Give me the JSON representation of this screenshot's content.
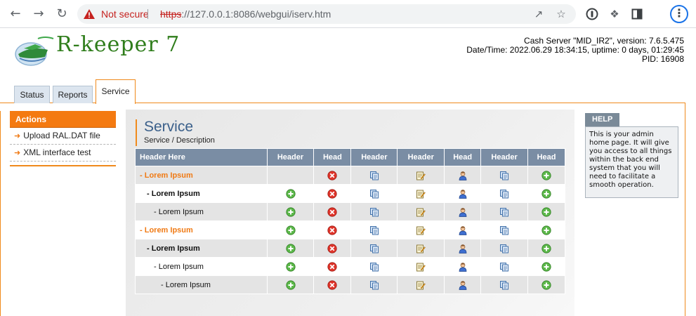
{
  "browser": {
    "security_label": "Not secure",
    "url_scheme": "https",
    "url_rest": "://127.0.0.1:8086/webgui/iserv.htm"
  },
  "app": {
    "logo_text": "R-keeper 7",
    "server_line1": "Cash Server \"MID_IR2\", version: 7.6.5.475",
    "server_line2": "Date/Time: 2022.06.29 18:34:15, uptime: 0 days, 01:29:45",
    "server_line3": "PID: 16908"
  },
  "tabs": [
    {
      "label": "Status"
    },
    {
      "label": "Reports"
    },
    {
      "label": "Service"
    }
  ],
  "actions": {
    "title": "Actions",
    "items": [
      {
        "label": "Upload RAL.DAT file"
      },
      {
        "label": "XML interface test"
      }
    ]
  },
  "main": {
    "title": "Service",
    "subtitle": "Service / Description"
  },
  "table": {
    "headers": [
      "Header Here",
      "Header",
      "Head",
      "Header",
      "Header",
      "Head",
      "Header",
      "Head"
    ],
    "rows": [
      {
        "label": "- Lorem Ipsum",
        "level": 0,
        "cells": [
          "",
          "delete",
          "copy",
          "edit",
          "user",
          "copy",
          "add"
        ]
      },
      {
        "label": "- Lorem Ipsum",
        "level": 1,
        "cells": [
          "add",
          "delete",
          "copy",
          "edit",
          "user",
          "copy",
          "add"
        ]
      },
      {
        "label": "- Lorem Ipsum",
        "level": 2,
        "cells": [
          "add",
          "delete",
          "copy",
          "edit",
          "user",
          "copy",
          "add"
        ]
      },
      {
        "label": "- Lorem Ipsum",
        "level": 0,
        "cells": [
          "add",
          "delete",
          "copy",
          "edit",
          "user",
          "copy",
          "add"
        ]
      },
      {
        "label": "- Lorem Ipsum",
        "level": 1,
        "cells": [
          "add",
          "delete",
          "copy",
          "edit",
          "user",
          "copy",
          "add"
        ]
      },
      {
        "label": "- Lorem Ipsum",
        "level": 2,
        "cells": [
          "add",
          "delete",
          "copy",
          "edit",
          "user",
          "copy",
          "add"
        ]
      },
      {
        "label": "- Lorem Ipsum",
        "level": 3,
        "cells": [
          "add",
          "delete",
          "copy",
          "edit",
          "user",
          "copy",
          "add"
        ]
      }
    ]
  },
  "help": {
    "title": "HELP",
    "text": "This is your admin home page. It will give you access to all things within the back end system that you will need to facilitate a smooth operation."
  },
  "colors": {
    "accent_orange": "#f07a14",
    "header_blue": "#7a8da4",
    "title_blue": "#3a5f8a",
    "logo_green": "#2f7d1b"
  }
}
